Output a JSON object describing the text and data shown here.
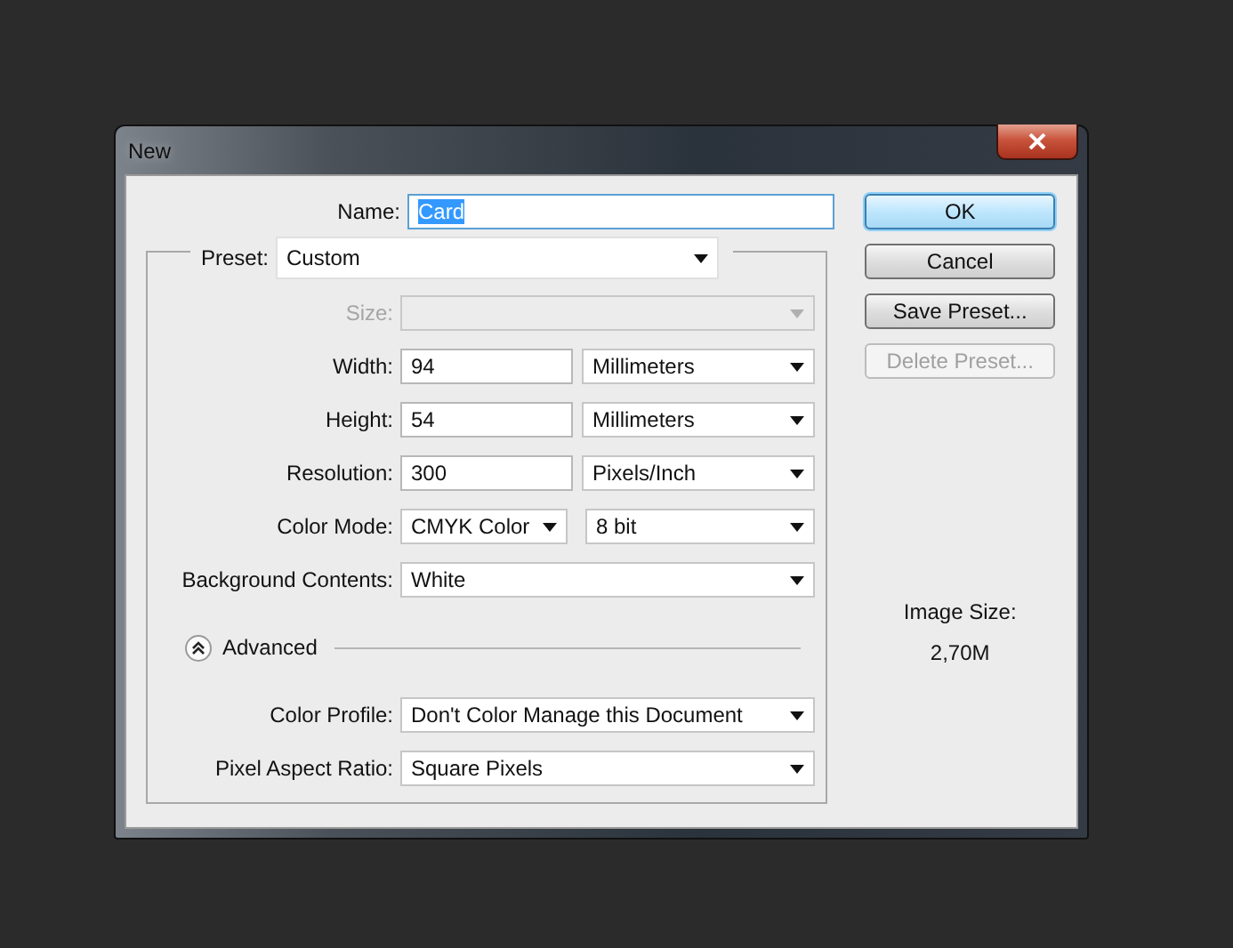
{
  "window": {
    "title": "New"
  },
  "name": {
    "label": "Name:",
    "value": "Card",
    "text_selected": true
  },
  "preset": {
    "label": "Preset:",
    "value": "Custom"
  },
  "rows": [
    {
      "label": "Size:",
      "disabled": true,
      "controls": [
        {
          "kind": "select"
        }
      ]
    },
    {
      "label": "Width:",
      "disabled": false,
      "controls": [
        {
          "kind": "input",
          "value": "94"
        },
        {
          "kind": "select",
          "value": "Millimeters"
        }
      ]
    },
    {
      "label": "Height:",
      "disabled": false,
      "controls": [
        {
          "kind": "input",
          "value": "54"
        },
        {
          "kind": "select",
          "value": "Millimeters"
        }
      ]
    },
    {
      "label": "Resolution:",
      "disabled": false,
      "controls": [
        {
          "kind": "input",
          "value": "300"
        },
        {
          "kind": "select",
          "value": "Pixels/Inch"
        }
      ]
    },
    {
      "label": "Color Mode:",
      "disabled": false,
      "controls": [
        {
          "kind": "select",
          "value": "CMYK Color"
        },
        {
          "kind": "select",
          "value": "8 bit"
        }
      ]
    },
    {
      "label": "Background Contents:",
      "disabled": false,
      "controls": [
        {
          "kind": "select",
          "value": "White"
        }
      ]
    }
  ],
  "advanced": {
    "label": "Advanced",
    "expanded": true
  },
  "advanced_rows": [
    {
      "label": "Color Profile:",
      "disabled": false,
      "controls": [
        {
          "kind": "select",
          "value": "Don't Color Manage this Document"
        }
      ]
    },
    {
      "label": "Pixel Aspect Ratio:",
      "disabled": false,
      "controls": [
        {
          "kind": "select",
          "value": "Square Pixels"
        }
      ]
    }
  ],
  "buttons": [
    {
      "label": "OK",
      "default": true,
      "disabled": false
    },
    {
      "label": "Cancel",
      "default": false,
      "disabled": false
    },
    {
      "label": "Save Preset...",
      "default": false,
      "disabled": false
    },
    {
      "label": "Delete Preset...",
      "default": false,
      "disabled": true
    }
  ],
  "image_size": {
    "label": "Image Size:",
    "value": "2,70M"
  }
}
